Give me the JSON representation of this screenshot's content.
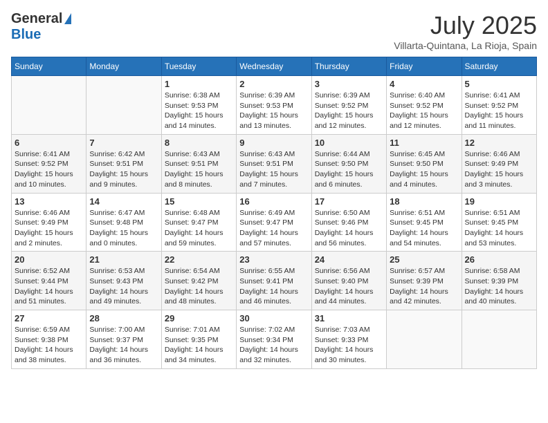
{
  "header": {
    "logo_general": "General",
    "logo_blue": "Blue",
    "month_title": "July 2025",
    "location": "Villarta-Quintana, La Rioja, Spain"
  },
  "weekdays": [
    "Sunday",
    "Monday",
    "Tuesday",
    "Wednesday",
    "Thursday",
    "Friday",
    "Saturday"
  ],
  "weeks": [
    [
      {
        "day": "",
        "sunrise": "",
        "sunset": "",
        "daylight": ""
      },
      {
        "day": "",
        "sunrise": "",
        "sunset": "",
        "daylight": ""
      },
      {
        "day": "1",
        "sunrise": "Sunrise: 6:38 AM",
        "sunset": "Sunset: 9:53 PM",
        "daylight": "Daylight: 15 hours and 14 minutes."
      },
      {
        "day": "2",
        "sunrise": "Sunrise: 6:39 AM",
        "sunset": "Sunset: 9:53 PM",
        "daylight": "Daylight: 15 hours and 13 minutes."
      },
      {
        "day": "3",
        "sunrise": "Sunrise: 6:39 AM",
        "sunset": "Sunset: 9:52 PM",
        "daylight": "Daylight: 15 hours and 12 minutes."
      },
      {
        "day": "4",
        "sunrise": "Sunrise: 6:40 AM",
        "sunset": "Sunset: 9:52 PM",
        "daylight": "Daylight: 15 hours and 12 minutes."
      },
      {
        "day": "5",
        "sunrise": "Sunrise: 6:41 AM",
        "sunset": "Sunset: 9:52 PM",
        "daylight": "Daylight: 15 hours and 11 minutes."
      }
    ],
    [
      {
        "day": "6",
        "sunrise": "Sunrise: 6:41 AM",
        "sunset": "Sunset: 9:52 PM",
        "daylight": "Daylight: 15 hours and 10 minutes."
      },
      {
        "day": "7",
        "sunrise": "Sunrise: 6:42 AM",
        "sunset": "Sunset: 9:51 PM",
        "daylight": "Daylight: 15 hours and 9 minutes."
      },
      {
        "day": "8",
        "sunrise": "Sunrise: 6:43 AM",
        "sunset": "Sunset: 9:51 PM",
        "daylight": "Daylight: 15 hours and 8 minutes."
      },
      {
        "day": "9",
        "sunrise": "Sunrise: 6:43 AM",
        "sunset": "Sunset: 9:51 PM",
        "daylight": "Daylight: 15 hours and 7 minutes."
      },
      {
        "day": "10",
        "sunrise": "Sunrise: 6:44 AM",
        "sunset": "Sunset: 9:50 PM",
        "daylight": "Daylight: 15 hours and 6 minutes."
      },
      {
        "day": "11",
        "sunrise": "Sunrise: 6:45 AM",
        "sunset": "Sunset: 9:50 PM",
        "daylight": "Daylight: 15 hours and 4 minutes."
      },
      {
        "day": "12",
        "sunrise": "Sunrise: 6:46 AM",
        "sunset": "Sunset: 9:49 PM",
        "daylight": "Daylight: 15 hours and 3 minutes."
      }
    ],
    [
      {
        "day": "13",
        "sunrise": "Sunrise: 6:46 AM",
        "sunset": "Sunset: 9:49 PM",
        "daylight": "Daylight: 15 hours and 2 minutes."
      },
      {
        "day": "14",
        "sunrise": "Sunrise: 6:47 AM",
        "sunset": "Sunset: 9:48 PM",
        "daylight": "Daylight: 15 hours and 0 minutes."
      },
      {
        "day": "15",
        "sunrise": "Sunrise: 6:48 AM",
        "sunset": "Sunset: 9:47 PM",
        "daylight": "Daylight: 14 hours and 59 minutes."
      },
      {
        "day": "16",
        "sunrise": "Sunrise: 6:49 AM",
        "sunset": "Sunset: 9:47 PM",
        "daylight": "Daylight: 14 hours and 57 minutes."
      },
      {
        "day": "17",
        "sunrise": "Sunrise: 6:50 AM",
        "sunset": "Sunset: 9:46 PM",
        "daylight": "Daylight: 14 hours and 56 minutes."
      },
      {
        "day": "18",
        "sunrise": "Sunrise: 6:51 AM",
        "sunset": "Sunset: 9:45 PM",
        "daylight": "Daylight: 14 hours and 54 minutes."
      },
      {
        "day": "19",
        "sunrise": "Sunrise: 6:51 AM",
        "sunset": "Sunset: 9:45 PM",
        "daylight": "Daylight: 14 hours and 53 minutes."
      }
    ],
    [
      {
        "day": "20",
        "sunrise": "Sunrise: 6:52 AM",
        "sunset": "Sunset: 9:44 PM",
        "daylight": "Daylight: 14 hours and 51 minutes."
      },
      {
        "day": "21",
        "sunrise": "Sunrise: 6:53 AM",
        "sunset": "Sunset: 9:43 PM",
        "daylight": "Daylight: 14 hours and 49 minutes."
      },
      {
        "day": "22",
        "sunrise": "Sunrise: 6:54 AM",
        "sunset": "Sunset: 9:42 PM",
        "daylight": "Daylight: 14 hours and 48 minutes."
      },
      {
        "day": "23",
        "sunrise": "Sunrise: 6:55 AM",
        "sunset": "Sunset: 9:41 PM",
        "daylight": "Daylight: 14 hours and 46 minutes."
      },
      {
        "day": "24",
        "sunrise": "Sunrise: 6:56 AM",
        "sunset": "Sunset: 9:40 PM",
        "daylight": "Daylight: 14 hours and 44 minutes."
      },
      {
        "day": "25",
        "sunrise": "Sunrise: 6:57 AM",
        "sunset": "Sunset: 9:39 PM",
        "daylight": "Daylight: 14 hours and 42 minutes."
      },
      {
        "day": "26",
        "sunrise": "Sunrise: 6:58 AM",
        "sunset": "Sunset: 9:39 PM",
        "daylight": "Daylight: 14 hours and 40 minutes."
      }
    ],
    [
      {
        "day": "27",
        "sunrise": "Sunrise: 6:59 AM",
        "sunset": "Sunset: 9:38 PM",
        "daylight": "Daylight: 14 hours and 38 minutes."
      },
      {
        "day": "28",
        "sunrise": "Sunrise: 7:00 AM",
        "sunset": "Sunset: 9:37 PM",
        "daylight": "Daylight: 14 hours and 36 minutes."
      },
      {
        "day": "29",
        "sunrise": "Sunrise: 7:01 AM",
        "sunset": "Sunset: 9:35 PM",
        "daylight": "Daylight: 14 hours and 34 minutes."
      },
      {
        "day": "30",
        "sunrise": "Sunrise: 7:02 AM",
        "sunset": "Sunset: 9:34 PM",
        "daylight": "Daylight: 14 hours and 32 minutes."
      },
      {
        "day": "31",
        "sunrise": "Sunrise: 7:03 AM",
        "sunset": "Sunset: 9:33 PM",
        "daylight": "Daylight: 14 hours and 30 minutes."
      },
      {
        "day": "",
        "sunrise": "",
        "sunset": "",
        "daylight": ""
      },
      {
        "day": "",
        "sunrise": "",
        "sunset": "",
        "daylight": ""
      }
    ]
  ]
}
